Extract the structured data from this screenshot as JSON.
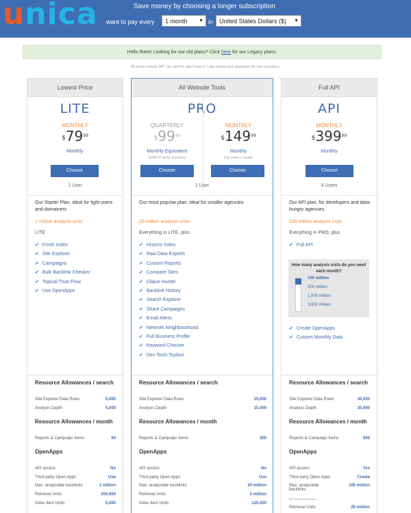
{
  "header": {
    "save_text": "Save money by choosing a longer subscription",
    "want_text": "want to pay every",
    "in_text": "in",
    "period_value": "1 month",
    "currency_value": "United States Dollars ($)"
  },
  "notice": {
    "before": "Hello there! Looking for our old plans? Click ",
    "link": "here",
    "after": " for our Legacy plans."
  },
  "guarantee": "All prices exclude VAT. Lite and Pro plans have a 7-day money-back guarantee for new customers.",
  "lite": {
    "header": "Lowest Price",
    "name": "LITE",
    "period": "MONTHLY",
    "currency": "$",
    "amount": "79",
    "cents": "99",
    "billing": "Monthly",
    "button": "Choose",
    "users": "1 User",
    "desc": "Our Starter Plan, ideal for light users and domainers",
    "units": "1 million analysis units",
    "included": "LITE",
    "features": [
      "Fresh Index",
      "Site Explorer",
      "Campaigns",
      "Bulk Backlink Checker",
      "Topical Trust Flow",
      "Use OpenApps"
    ],
    "res_search_title": "Resource Allowances / search",
    "res_search": [
      {
        "k": "Site Explorer Data Rows",
        "v": "5,000"
      },
      {
        "k": "Analysis Depth",
        "v": "5,000"
      }
    ],
    "res_month_title": "Resource Allowances / month",
    "res_month": [
      {
        "k": "Reports & Campaign Items",
        "v": "60"
      }
    ],
    "openapps_title": "OpenApps",
    "openapps": [
      {
        "k": "API access",
        "v": "No"
      },
      {
        "k": "Third party Open Apps",
        "v": "Use"
      },
      {
        "k": "Max. analyzable backlinks",
        "v": "1 million"
      },
      {
        "k": "Retrieval Units",
        "v": "200,000"
      },
      {
        "k": "Index Item Units",
        "v": "5,000"
      }
    ]
  },
  "pro": {
    "header": "All Website Tools",
    "name": "PRO",
    "q_period": "QUARTERLY",
    "q_currency": "$",
    "q_amount": "99",
    "q_cents": "99",
    "q_billing": "Monthly Equivalent",
    "q_sub": "$299.97 every 3 months",
    "q_button": "Choose",
    "m_period": "MONTHLY",
    "m_currency": "$",
    "m_amount": "149",
    "m_cents": "99",
    "m_billing": "Monthly",
    "m_sub": "Pay every 1 month",
    "m_button": "Choose",
    "users": "1 User",
    "desc": "Our most popular plan, ideal for smaller agencies",
    "units": "20 million analysis units",
    "included": "Everything in LITE, plus",
    "features": [
      "Historic Index",
      "Raw Data Exports",
      "Custom Reports",
      "Compare Sites",
      "Clique Hunter",
      "Backlink History",
      "Search Explorer",
      "Share Campaigns",
      "Email Alerts",
      "Network Neighbourhood",
      "Full Business Profile",
      "Keyword Checker",
      "Dev Tools Toybox"
    ],
    "res_search_title": "Resource Allowances / search",
    "res_search": [
      {
        "k": "Site Explorer Data Rows",
        "v": "15,000"
      },
      {
        "k": "Analysis Depth",
        "v": "15,000"
      }
    ],
    "res_month_title": "Resource Allowances / month",
    "res_month": [
      {
        "k": "Reports & Campaign Items",
        "v": "300"
      }
    ],
    "openapps_title": "OpenApps",
    "openapps": [
      {
        "k": "API access",
        "v": "No"
      },
      {
        "k": "Third party Open Apps",
        "v": "Use"
      },
      {
        "k": "Max. analyzable backlinks",
        "v": "20 million"
      },
      {
        "k": "Retrieval Units",
        "v": "5 million"
      },
      {
        "k": "Index Item Units",
        "v": "125,000"
      }
    ]
  },
  "api": {
    "header": "Full API",
    "name": "API",
    "period": "MONTHLY",
    "currency": "$",
    "amount": "399",
    "cents": "99",
    "billing": "Monthly",
    "button": "Choose",
    "users": "4 Users",
    "desc": "Our API plan, for developers and data-hungry agencies",
    "units": "100 million analysis units",
    "included": "Everything in PRO, plus",
    "features": [
      "Full API"
    ],
    "question": "How many analysis units do you need each month?",
    "unit_options": [
      "100 million",
      "300 million",
      "1,000 million",
      "3,000 million"
    ],
    "unit_selected_index": 0,
    "features2": [
      "Create OpenApps",
      "Custom Monthly Data"
    ],
    "res_search_title": "Resource Allowances / search",
    "res_search": [
      {
        "k": "Site Explorer Data Rows",
        "v": "30,000"
      },
      {
        "k": "Analysis Depth",
        "v": "30,000"
      }
    ],
    "res_month_title": "Resource Allowances / month",
    "res_month": [
      {
        "k": "Reports & Campaign Items",
        "v": "950"
      }
    ],
    "openapps_title": "OpenApps",
    "openapps": [
      {
        "k": "API access",
        "v": "Yes"
      },
      {
        "k": "Third party Open Apps",
        "v": "Create"
      },
      {
        "k": "Max. analyzable backlinks",
        "v": "100 million"
      },
      {
        "k": "Retrieval Units",
        "v": "20 million"
      }
    ],
    "api_sub": "API AnalysisBacklinks"
  }
}
